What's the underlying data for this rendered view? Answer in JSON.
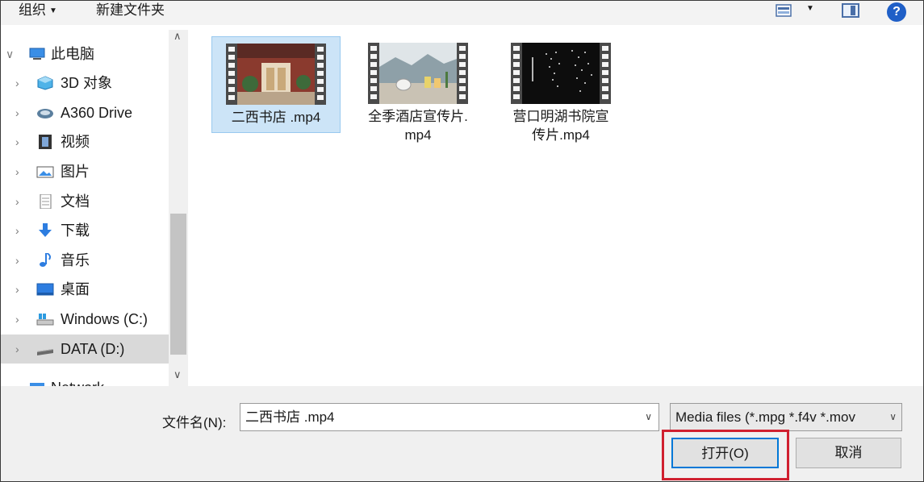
{
  "toolbar": {
    "organize": "组织",
    "new_folder": "新建文件夹"
  },
  "nav": {
    "items": [
      {
        "label": "此电脑",
        "icon": "pc-icon"
      },
      {
        "label": "3D 对象",
        "icon": "cube-icon"
      },
      {
        "label": "A360 Drive",
        "icon": "cloud-drive-icon"
      },
      {
        "label": "视频",
        "icon": "video-icon"
      },
      {
        "label": "图片",
        "icon": "picture-icon"
      },
      {
        "label": "文档",
        "icon": "document-icon"
      },
      {
        "label": "下载",
        "icon": "download-icon"
      },
      {
        "label": "音乐",
        "icon": "music-icon"
      },
      {
        "label": "桌面",
        "icon": "desktop-icon"
      },
      {
        "label": "Windows (C:)",
        "icon": "drive-c-icon"
      },
      {
        "label": "DATA (D:)",
        "icon": "drive-d-icon"
      },
      {
        "label": "Network",
        "icon": "network-icon"
      }
    ]
  },
  "files": [
    {
      "line1": "二西书店 .mp4",
      "line2": ""
    },
    {
      "line1": "全季酒店宣传片.",
      "line2": "mp4"
    },
    {
      "line1": "营口明湖书院宣",
      "line2": "传片.mp4"
    }
  ],
  "bottom": {
    "filename_label": "文件名(N):",
    "filename_value": "二西书店 .mp4",
    "filter_value": "Media files (*.mpg *.f4v *.mov",
    "open_button": "打开(O)",
    "cancel_button": "取消"
  },
  "colors": {
    "accent": "#0078d7",
    "highlight": "#d02030",
    "selection": "#cce4f7"
  }
}
